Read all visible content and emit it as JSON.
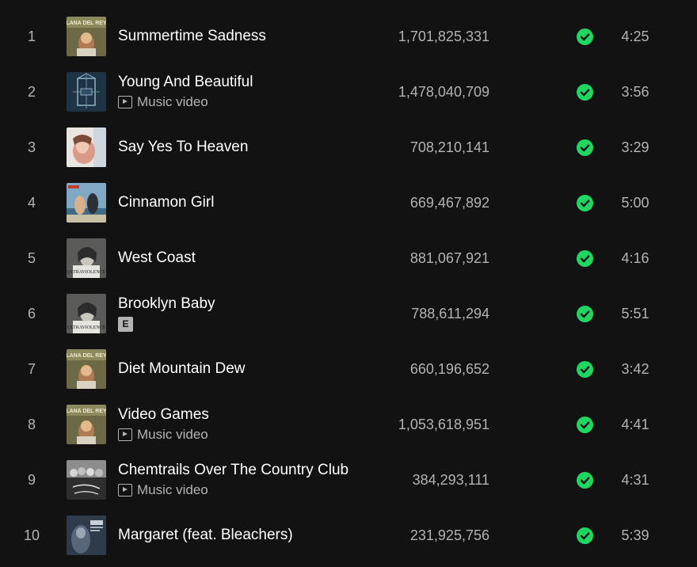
{
  "tracks": [
    {
      "index": "1",
      "title": "Summertime Sadness",
      "plays": "1,701,825,331",
      "duration": "4:25",
      "music_video": false,
      "explicit": false,
      "cover": "born-to-die"
    },
    {
      "index": "2",
      "title": "Young And Beautiful",
      "plays": "1,478,040,709",
      "duration": "3:56",
      "music_video": true,
      "explicit": false,
      "cover": "gatsby"
    },
    {
      "index": "3",
      "title": "Say Yes To Heaven",
      "plays": "708,210,141",
      "duration": "3:29",
      "music_video": false,
      "explicit": false,
      "cover": "say-yes"
    },
    {
      "index": "4",
      "title": "Cinnamon Girl",
      "plays": "669,467,892",
      "duration": "5:00",
      "music_video": false,
      "explicit": false,
      "cover": "nfr"
    },
    {
      "index": "5",
      "title": "West Coast",
      "plays": "881,067,921",
      "duration": "4:16",
      "music_video": false,
      "explicit": false,
      "cover": "ultraviolence"
    },
    {
      "index": "6",
      "title": "Brooklyn Baby",
      "plays": "788,611,294",
      "duration": "5:51",
      "music_video": false,
      "explicit": true,
      "cover": "ultraviolence"
    },
    {
      "index": "7",
      "title": "Diet Mountain Dew",
      "plays": "660,196,652",
      "duration": "3:42",
      "music_video": false,
      "explicit": false,
      "cover": "born-to-die"
    },
    {
      "index": "8",
      "title": "Video Games",
      "plays": "1,053,618,951",
      "duration": "4:41",
      "music_video": true,
      "explicit": false,
      "cover": "born-to-die"
    },
    {
      "index": "9",
      "title": "Chemtrails Over The Country Club",
      "plays": "384,293,111",
      "duration": "4:31",
      "music_video": true,
      "explicit": false,
      "cover": "chemtrails"
    },
    {
      "index": "10",
      "title": "Margaret (feat. Bleachers)",
      "plays": "231,925,756",
      "duration": "5:39",
      "music_video": false,
      "explicit": false,
      "cover": "tunnel"
    }
  ],
  "labels": {
    "music_video": "Music video",
    "explicit": "E"
  },
  "colors": {
    "background": "#121212",
    "text_primary": "#ffffff",
    "text_secondary": "#b3b3b3",
    "saved_check": "#1ed760"
  },
  "icons": {
    "saved": "check-circle-icon",
    "music_video": "play-box-icon",
    "explicit": "explicit-badge"
  },
  "cover_text": {
    "born-to-die": "LANA DEL REY",
    "ultraviolence": "ULTRAVIOLENCE"
  }
}
